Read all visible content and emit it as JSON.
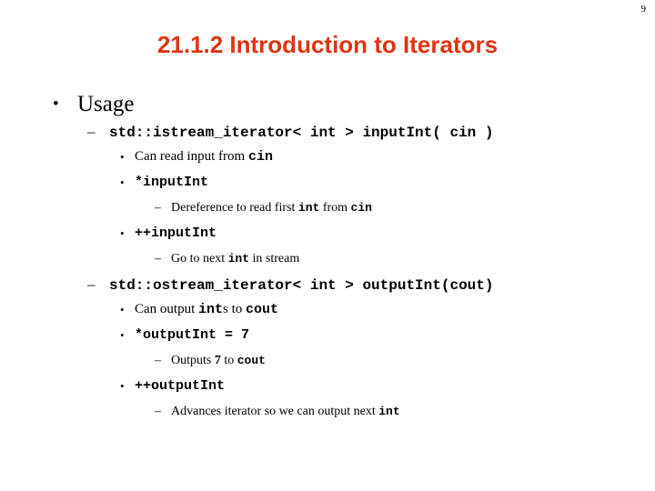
{
  "slide": {
    "page_number": "9",
    "title": "21.1.2 Introduction to Iterators",
    "title_color": "#E03412",
    "background_color": "#FFFFFF",
    "text_color": "#000000",
    "bullet_marker_level1": "•",
    "bullet_marker_level2": "–",
    "bullet_marker_level3": "•",
    "bullet_marker_level4": "–",
    "lines": [
      {
        "level": 1,
        "marker": "•",
        "text": "Usage",
        "runs": [
          {
            "t": "Usage",
            "style": "serif"
          }
        ]
      },
      {
        "level": 2,
        "marker": "–",
        "text": "std::istream_iterator< int > inputInt( cin )",
        "runs": [
          {
            "t": "std::istream_iterator< int > inputInt( cin )",
            "style": "code"
          }
        ]
      },
      {
        "level": 3,
        "marker": "•",
        "text": "Can read input from cin",
        "runs": [
          {
            "t": "Can read input from ",
            "style": "serif"
          },
          {
            "t": "cin",
            "style": "code"
          }
        ]
      },
      {
        "level": 3,
        "marker": "•",
        "text": "*inputInt",
        "runs": [
          {
            "t": "*inputInt",
            "style": "code"
          }
        ]
      },
      {
        "level": 4,
        "marker": "–",
        "text": "Dereference to read first int from cin",
        "runs": [
          {
            "t": "Dereference to read first ",
            "style": "serif"
          },
          {
            "t": "int",
            "style": "code"
          },
          {
            "t": " from ",
            "style": "serif"
          },
          {
            "t": "cin",
            "style": "code"
          }
        ]
      },
      {
        "level": 3,
        "marker": "•",
        "text": "++inputInt",
        "runs": [
          {
            "t": "++inputInt",
            "style": "code"
          }
        ]
      },
      {
        "level": 4,
        "marker": "–",
        "text": "Go to next int in stream",
        "runs": [
          {
            "t": "Go to next ",
            "style": "serif"
          },
          {
            "t": "int",
            "style": "code"
          },
          {
            "t": " in stream",
            "style": "serif"
          }
        ]
      },
      {
        "level": 2,
        "marker": "–",
        "text": "std::ostream_iterator< int > outputInt(cout)",
        "runs": [
          {
            "t": "std::ostream_iterator< int > outputInt(cout)",
            "style": "code"
          }
        ]
      },
      {
        "level": 3,
        "marker": "•",
        "text": "Can output ints to cout",
        "runs": [
          {
            "t": "Can output ",
            "style": "serif"
          },
          {
            "t": "int",
            "style": "code"
          },
          {
            "t": "s",
            "style": "serif"
          },
          {
            "t": " to ",
            "style": "serif"
          },
          {
            "t": "cout",
            "style": "code"
          }
        ]
      },
      {
        "level": 3,
        "marker": "•",
        "text": "*outputInt = 7",
        "runs": [
          {
            "t": "*outputInt = 7",
            "style": "code"
          }
        ]
      },
      {
        "level": 4,
        "marker": "–",
        "text": "Outputs 7 to cout",
        "runs": [
          {
            "t": "Outputs ",
            "style": "serif"
          },
          {
            "t": "7",
            "style": "bold-serif"
          },
          {
            "t": " to ",
            "style": "serif"
          },
          {
            "t": "cout",
            "style": "code"
          }
        ]
      },
      {
        "level": 3,
        "marker": "•",
        "text": "++outputInt",
        "runs": [
          {
            "t": "++outputInt",
            "style": "code"
          }
        ]
      },
      {
        "level": 4,
        "marker": "–",
        "text": "Advances iterator so we can output next int",
        "runs": [
          {
            "t": "Advances iterator so we can output next ",
            "style": "serif"
          },
          {
            "t": "int",
            "style": "code"
          }
        ]
      }
    ]
  }
}
